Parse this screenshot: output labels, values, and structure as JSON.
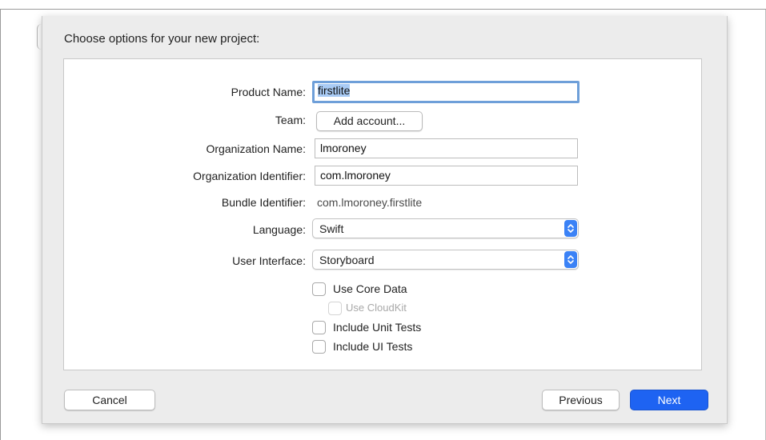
{
  "dialog": {
    "title": "Choose options for your new project:"
  },
  "form": {
    "product_name": {
      "label": "Product Name:",
      "value": "firstlite"
    },
    "team": {
      "label": "Team:",
      "button_label": "Add account..."
    },
    "organization_name": {
      "label": "Organization Name:",
      "value": "lmoroney"
    },
    "organization_identifier": {
      "label": "Organization Identifier:",
      "value": "com.lmoroney"
    },
    "bundle_identifier": {
      "label": "Bundle Identifier:",
      "value": "com.lmoroney.firstlite"
    },
    "language": {
      "label": "Language:",
      "selected": "Swift"
    },
    "user_interface": {
      "label": "User Interface:",
      "selected": "Storyboard"
    },
    "checkboxes": {
      "use_core_data": {
        "label": "Use Core Data",
        "checked": false,
        "enabled": true
      },
      "use_cloudkit": {
        "label": "Use CloudKit",
        "checked": false,
        "enabled": false
      },
      "include_unit_tests": {
        "label": "Include Unit Tests",
        "checked": false,
        "enabled": true
      },
      "include_ui_tests": {
        "label": "Include UI Tests",
        "checked": false,
        "enabled": true
      }
    }
  },
  "footer": {
    "cancel_label": "Cancel",
    "previous_label": "Previous",
    "next_label": "Next"
  },
  "colors": {
    "accent": "#1e63f2",
    "focus_ring": "#6e9fd9",
    "selection": "#a9cbf5"
  },
  "icons": {
    "popup_stepper": "up-down-chevron-icon"
  }
}
